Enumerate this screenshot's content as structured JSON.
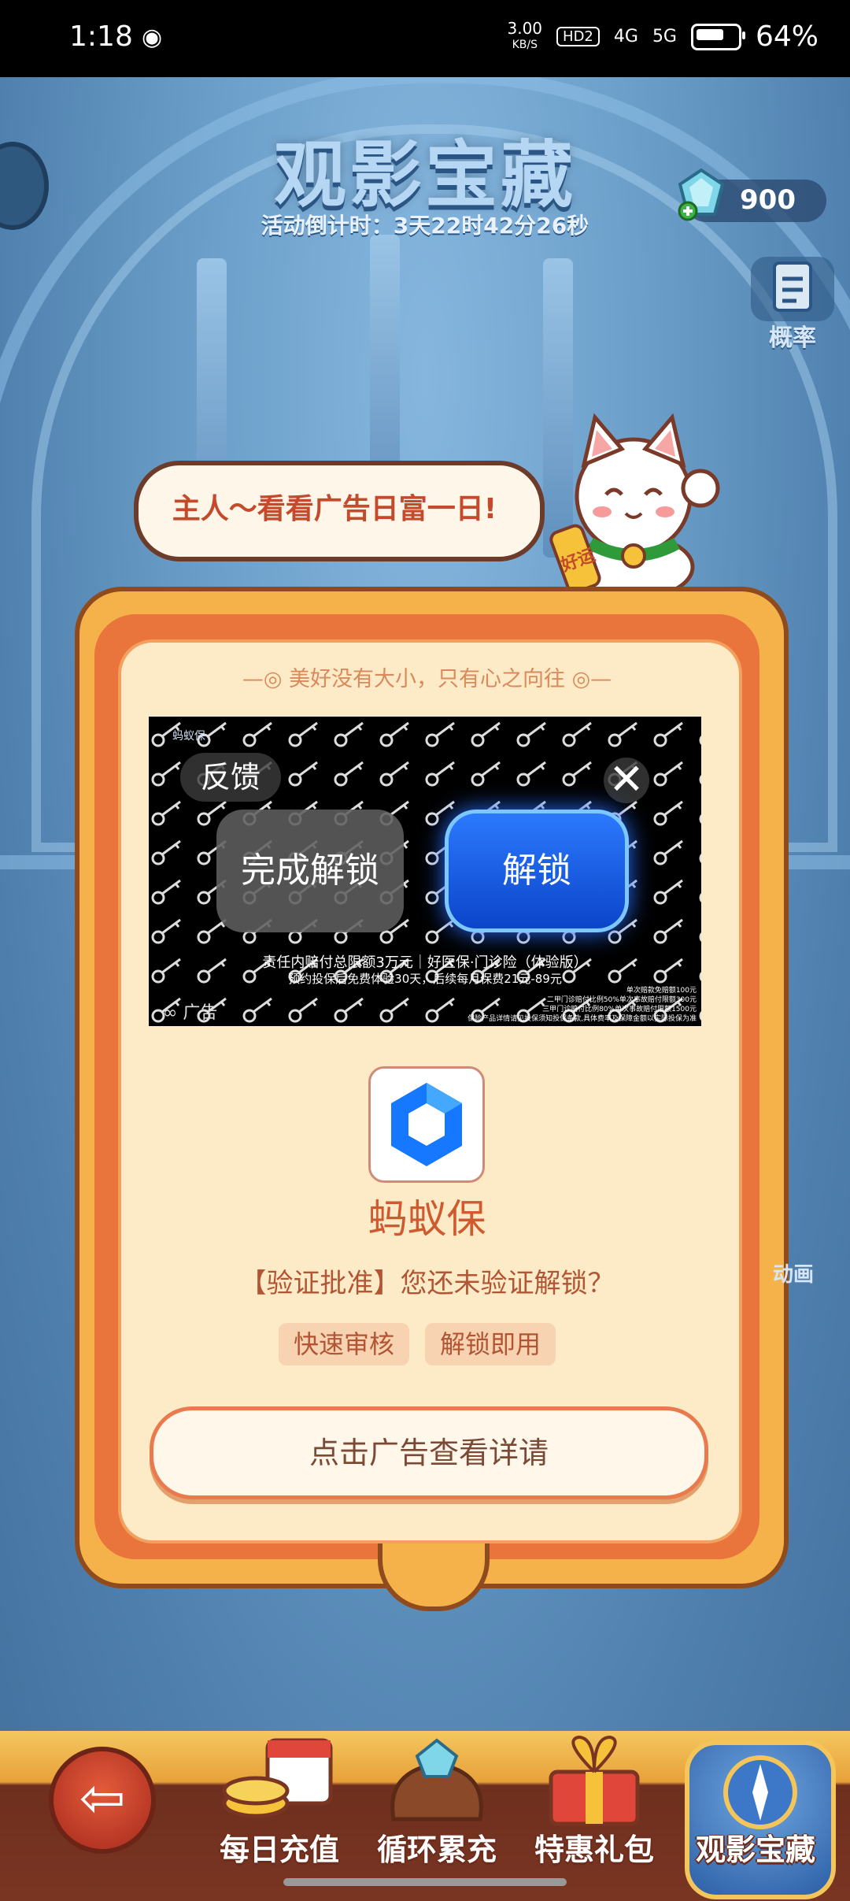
{
  "status_bar": {
    "time": "1:18",
    "speed": "3.00",
    "speed_unit": "KB/S",
    "hd": "HD2",
    "net1": "4G",
    "net2": "5G",
    "battery": "64%"
  },
  "header": {
    "title": "观影宝藏",
    "countdown": "活动倒计时：3天22时42分26秒",
    "gem_count": "900",
    "prob_label": "概率"
  },
  "speech": {
    "text": "主人～看看广告日富一日!"
  },
  "panel": {
    "subtitle": "—◎ 美好没有大小，只有心之向往 ◎—",
    "ad": {
      "feedback": "反馈",
      "close": "✕",
      "done_unlock": "完成解锁",
      "unlock": "解锁",
      "line1": "责任内赔付总限额3万元｜好医保·门诊险（体验版）",
      "line2": "预约投保后免费体验30天，后续每月保费21元-89元",
      "fine1": "单次赔款免赔额100元",
      "fine2": "二甲门诊赔付比例50%单次事故赔付限额300元",
      "fine3": "三甲门诊赔付比例80%单次事故赔付限额1500元",
      "fine4": "保险产品详情请见投保须知投保条款,具体费率及保障金额以实际投保为准",
      "ad_label": "广告",
      "logo": "蚂蚁保"
    },
    "app_name": "蚂蚁保",
    "verify_text": "【验证批准】您还未验证解锁？",
    "tags": [
      "快速审核",
      "解锁即用"
    ],
    "detail_button": "点击广告查看详请"
  },
  "side": {
    "anim": "动画"
  },
  "nav": {
    "back": "⇦",
    "tabs": [
      {
        "label": "每日充值"
      },
      {
        "label": "循环累充"
      },
      {
        "label": "特惠礼包"
      },
      {
        "label": "观影宝藏"
      }
    ]
  },
  "colors": {
    "accent_orange": "#e9743c",
    "panel_cream": "#fdebc8",
    "unlock_blue": "#1f63ec",
    "app_blue": "#1677ff"
  }
}
